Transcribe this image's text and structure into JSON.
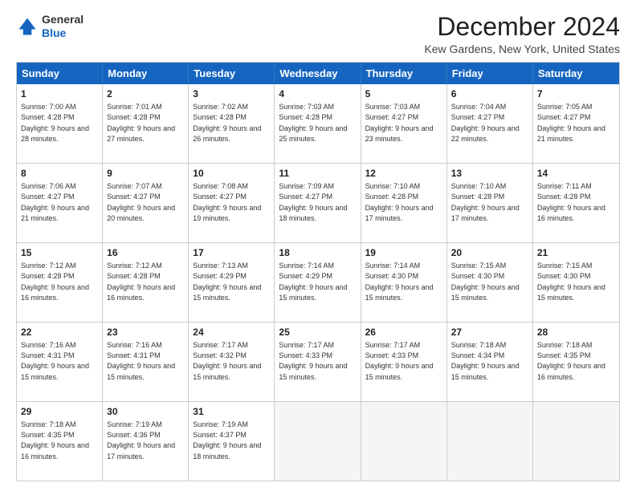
{
  "logo": {
    "general": "General",
    "blue": "Blue"
  },
  "title": "December 2024",
  "subtitle": "Kew Gardens, New York, United States",
  "days": [
    "Sunday",
    "Monday",
    "Tuesday",
    "Wednesday",
    "Thursday",
    "Friday",
    "Saturday"
  ],
  "weeks": [
    [
      {
        "day": "1",
        "sunrise": "7:00 AM",
        "sunset": "4:28 PM",
        "daylight": "9 hours and 28 minutes."
      },
      {
        "day": "2",
        "sunrise": "7:01 AM",
        "sunset": "4:28 PM",
        "daylight": "9 hours and 27 minutes."
      },
      {
        "day": "3",
        "sunrise": "7:02 AM",
        "sunset": "4:28 PM",
        "daylight": "9 hours and 26 minutes."
      },
      {
        "day": "4",
        "sunrise": "7:03 AM",
        "sunset": "4:28 PM",
        "daylight": "9 hours and 25 minutes."
      },
      {
        "day": "5",
        "sunrise": "7:03 AM",
        "sunset": "4:27 PM",
        "daylight": "9 hours and 23 minutes."
      },
      {
        "day": "6",
        "sunrise": "7:04 AM",
        "sunset": "4:27 PM",
        "daylight": "9 hours and 22 minutes."
      },
      {
        "day": "7",
        "sunrise": "7:05 AM",
        "sunset": "4:27 PM",
        "daylight": "9 hours and 21 minutes."
      }
    ],
    [
      {
        "day": "8",
        "sunrise": "7:06 AM",
        "sunset": "4:27 PM",
        "daylight": "9 hours and 21 minutes."
      },
      {
        "day": "9",
        "sunrise": "7:07 AM",
        "sunset": "4:27 PM",
        "daylight": "9 hours and 20 minutes."
      },
      {
        "day": "10",
        "sunrise": "7:08 AM",
        "sunset": "4:27 PM",
        "daylight": "9 hours and 19 minutes."
      },
      {
        "day": "11",
        "sunrise": "7:09 AM",
        "sunset": "4:27 PM",
        "daylight": "9 hours and 18 minutes."
      },
      {
        "day": "12",
        "sunrise": "7:10 AM",
        "sunset": "4:28 PM",
        "daylight": "9 hours and 17 minutes."
      },
      {
        "day": "13",
        "sunrise": "7:10 AM",
        "sunset": "4:28 PM",
        "daylight": "9 hours and 17 minutes."
      },
      {
        "day": "14",
        "sunrise": "7:11 AM",
        "sunset": "4:28 PM",
        "daylight": "9 hours and 16 minutes."
      }
    ],
    [
      {
        "day": "15",
        "sunrise": "7:12 AM",
        "sunset": "4:28 PM",
        "daylight": "9 hours and 16 minutes."
      },
      {
        "day": "16",
        "sunrise": "7:12 AM",
        "sunset": "4:28 PM",
        "daylight": "9 hours and 16 minutes."
      },
      {
        "day": "17",
        "sunrise": "7:13 AM",
        "sunset": "4:29 PM",
        "daylight": "9 hours and 15 minutes."
      },
      {
        "day": "18",
        "sunrise": "7:14 AM",
        "sunset": "4:29 PM",
        "daylight": "9 hours and 15 minutes."
      },
      {
        "day": "19",
        "sunrise": "7:14 AM",
        "sunset": "4:30 PM",
        "daylight": "9 hours and 15 minutes."
      },
      {
        "day": "20",
        "sunrise": "7:15 AM",
        "sunset": "4:30 PM",
        "daylight": "9 hours and 15 minutes."
      },
      {
        "day": "21",
        "sunrise": "7:15 AM",
        "sunset": "4:30 PM",
        "daylight": "9 hours and 15 minutes."
      }
    ],
    [
      {
        "day": "22",
        "sunrise": "7:16 AM",
        "sunset": "4:31 PM",
        "daylight": "9 hours and 15 minutes."
      },
      {
        "day": "23",
        "sunrise": "7:16 AM",
        "sunset": "4:31 PM",
        "daylight": "9 hours and 15 minutes."
      },
      {
        "day": "24",
        "sunrise": "7:17 AM",
        "sunset": "4:32 PM",
        "daylight": "9 hours and 15 minutes."
      },
      {
        "day": "25",
        "sunrise": "7:17 AM",
        "sunset": "4:33 PM",
        "daylight": "9 hours and 15 minutes."
      },
      {
        "day": "26",
        "sunrise": "7:17 AM",
        "sunset": "4:33 PM",
        "daylight": "9 hours and 15 minutes."
      },
      {
        "day": "27",
        "sunrise": "7:18 AM",
        "sunset": "4:34 PM",
        "daylight": "9 hours and 15 minutes."
      },
      {
        "day": "28",
        "sunrise": "7:18 AM",
        "sunset": "4:35 PM",
        "daylight": "9 hours and 16 minutes."
      }
    ],
    [
      {
        "day": "29",
        "sunrise": "7:18 AM",
        "sunset": "4:35 PM",
        "daylight": "9 hours and 16 minutes."
      },
      {
        "day": "30",
        "sunrise": "7:19 AM",
        "sunset": "4:36 PM",
        "daylight": "9 hours and 17 minutes."
      },
      {
        "day": "31",
        "sunrise": "7:19 AM",
        "sunset": "4:37 PM",
        "daylight": "9 hours and 18 minutes."
      },
      null,
      null,
      null,
      null
    ]
  ],
  "labels": {
    "sunrise": "Sunrise:",
    "sunset": "Sunset:",
    "daylight": "Daylight:"
  }
}
